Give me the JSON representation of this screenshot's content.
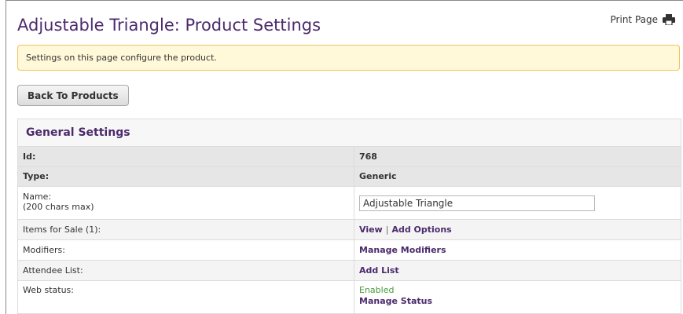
{
  "header": {
    "title": "Adjustable Triangle: Product Settings",
    "print_label": "Print Page"
  },
  "alert": {
    "text": "Settings on this page configure the product."
  },
  "actions": {
    "back_label": "Back To Products"
  },
  "general": {
    "title": "General Settings",
    "id_label": "Id:",
    "id_value": "768",
    "type_label": "Type:",
    "type_value": "Generic",
    "name_label": "Name:",
    "name_hint": "(200 chars max)",
    "name_value": "Adjustable Triangle",
    "items_label": "Items for Sale (1):",
    "view_link": "View",
    "separator": "|",
    "add_options_link": "Add Options",
    "modifiers_label": "Modifiers:",
    "manage_modifiers_link": "Manage Modifiers",
    "attendee_label": "Attendee List:",
    "add_list_link": "Add List",
    "web_status_label": "Web status:",
    "web_status_value": "Enabled",
    "manage_status_link": "Manage Status"
  },
  "colors": {
    "title": "#4b2a6d",
    "alert_bg": "#fff8d9",
    "alert_border": "#f1c35c",
    "enabled": "#4a9b3c"
  },
  "icons": {
    "print": "printer-icon"
  }
}
